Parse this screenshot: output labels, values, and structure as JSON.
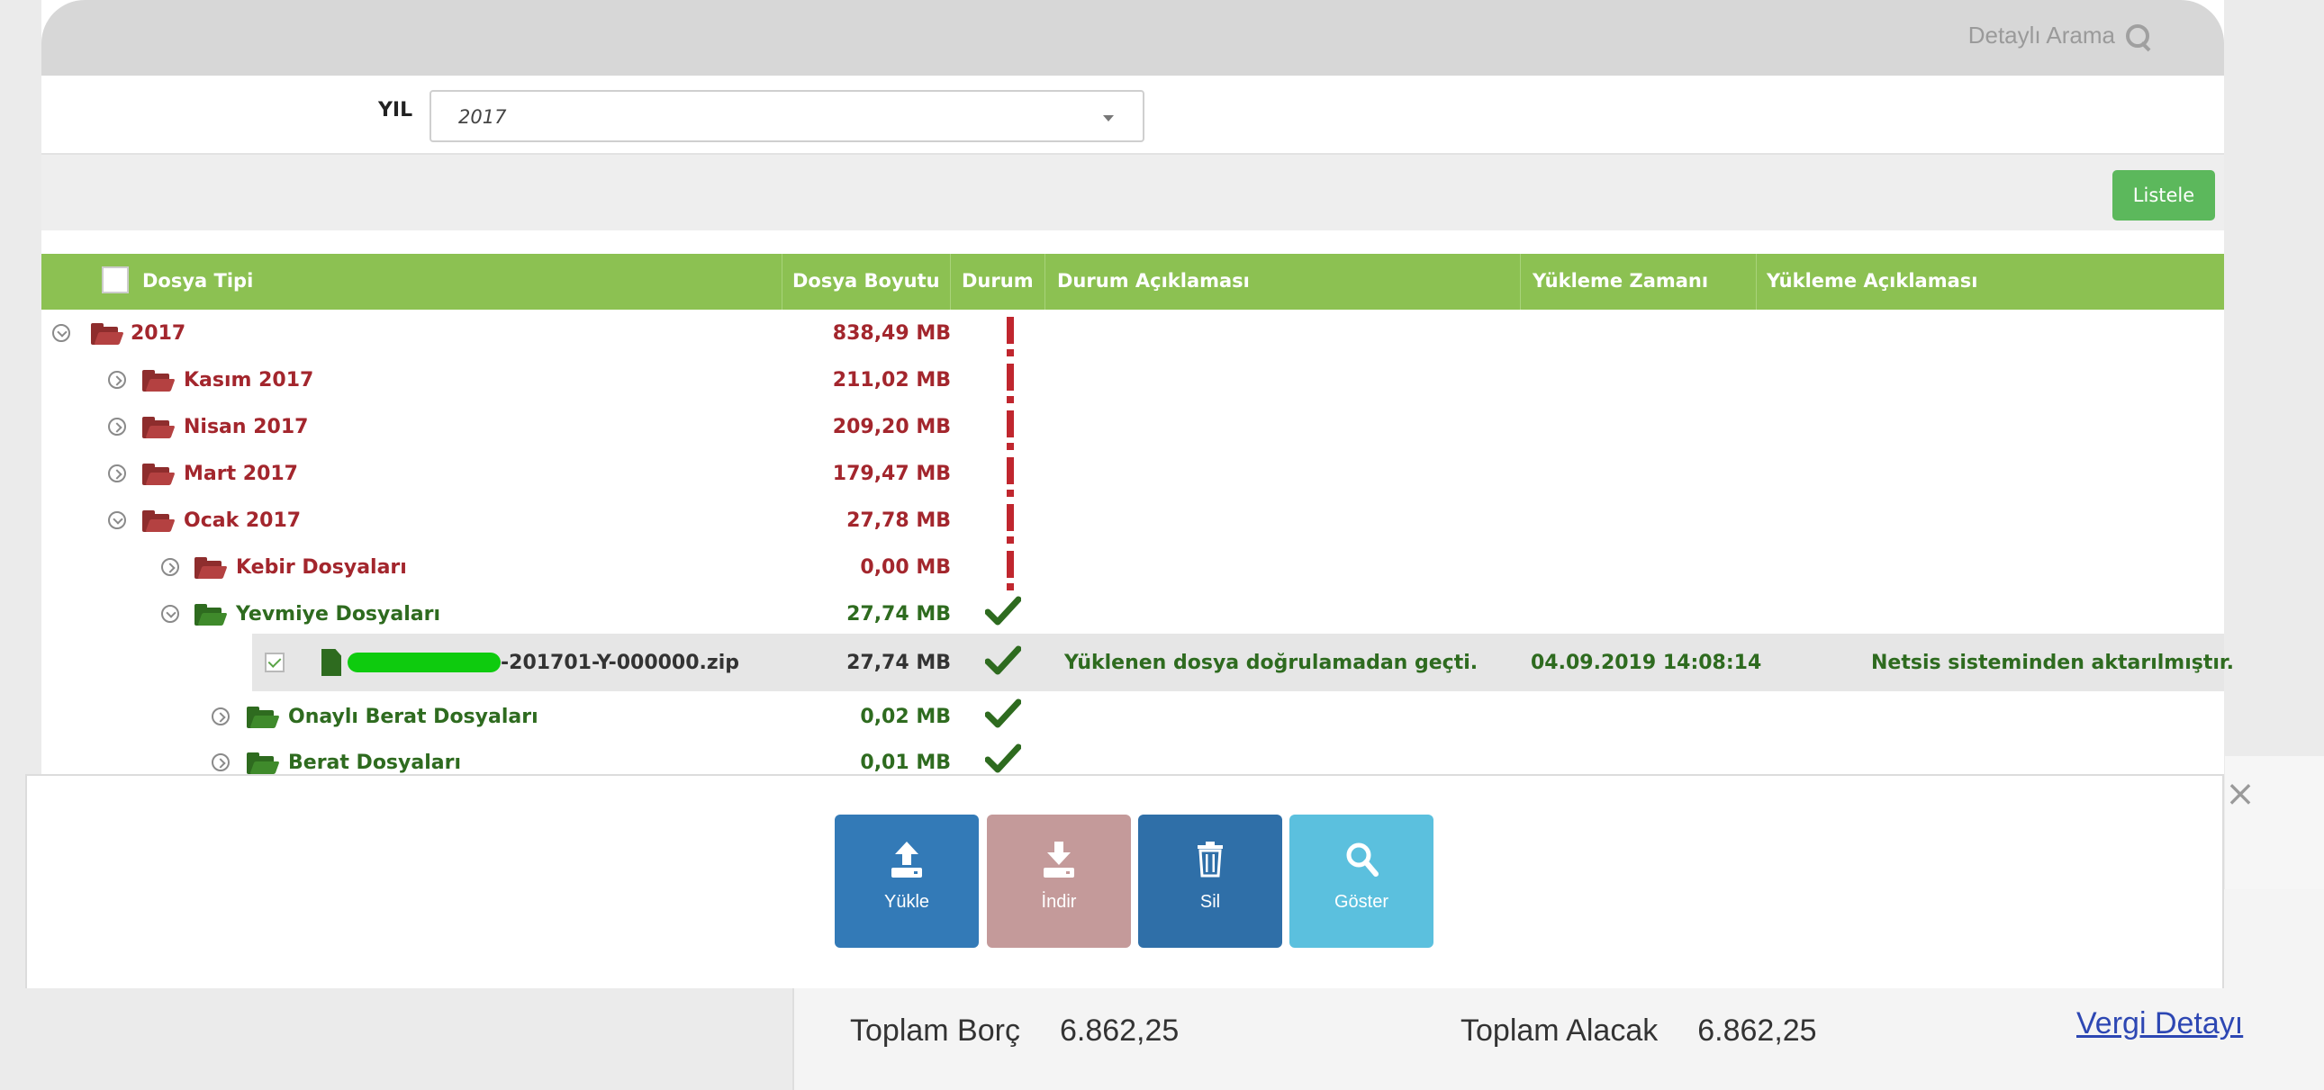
{
  "header": {
    "search_label": "Detaylı Arama",
    "search_icon": "search-icon"
  },
  "filter": {
    "year_label": "YIL",
    "year_value": "2017",
    "list_button": "Listele"
  },
  "table": {
    "columns": [
      "Dosya Tipi",
      "Dosya Boyutu",
      "Durum",
      "Durum Açıklaması",
      "Yükleme Zamanı",
      "Yükleme Açıklaması"
    ],
    "rows": [
      {
        "name": "2017",
        "size": "838,49 MB",
        "status": "error"
      },
      {
        "name": "Kasım 2017",
        "size": "211,02 MB",
        "status": "error"
      },
      {
        "name": "Nisan 2017",
        "size": "209,20 MB",
        "status": "error"
      },
      {
        "name": "Mart 2017",
        "size": "179,47 MB",
        "status": "error"
      },
      {
        "name": "Ocak 2017",
        "size": "27,78 MB",
        "status": "error"
      },
      {
        "name": "Kebir Dosyaları",
        "size": "0,00 MB",
        "status": "error"
      },
      {
        "name": "Yevmiye Dosyaları",
        "size": "27,74 MB",
        "status": "ok"
      },
      {
        "name": "-201701-Y-000000.zip",
        "size": "27,74 MB",
        "status": "ok",
        "status_text": "Yüklenen dosya doğrulamadan geçti.",
        "upload_time": "04.09.2019 14:08:14",
        "upload_note": "Netsis sisteminden aktarılmıştır."
      },
      {
        "name": "Onaylı Berat Dosyaları",
        "size": "0,02 MB",
        "status": "ok"
      },
      {
        "name": "Berat Dosyaları",
        "size": "0,01 MB",
        "status": "ok"
      }
    ]
  },
  "toolbar": {
    "upload": "Yükle",
    "download": "İndir",
    "delete": "Sil",
    "show": "Göster"
  },
  "totals": {
    "debt_label": "Toplam Borç",
    "debt_value": "6.862,25",
    "credit_label": "Toplam Alacak",
    "credit_value": "6.862,25",
    "tax_link": "Vergi Detayı"
  },
  "colors": {
    "accent_green": "#8cc152",
    "folder_red": "#a3262d",
    "folder_green": "#2e6b1f",
    "error_red": "#c0262e"
  }
}
